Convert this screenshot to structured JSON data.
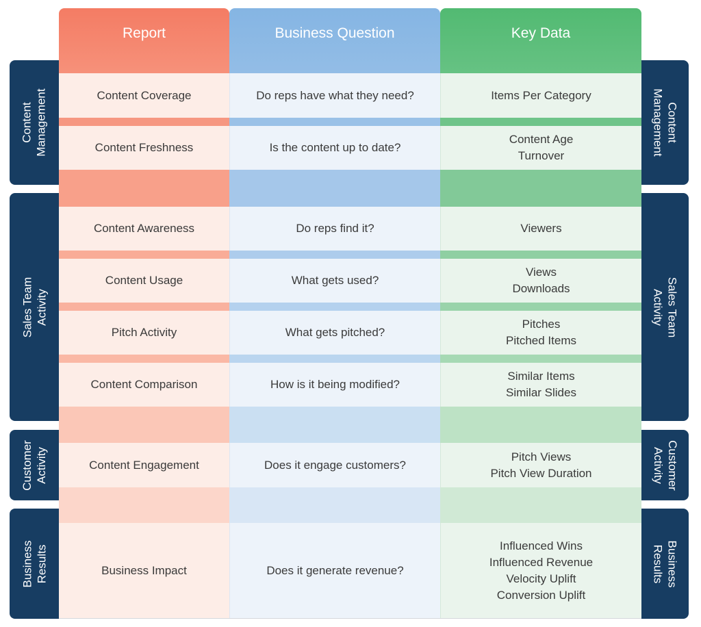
{
  "columns": {
    "report": {
      "header": "Report",
      "color": "#f47c64"
    },
    "question": {
      "header": "Business Question",
      "color": "#85b5e3"
    },
    "keydata": {
      "header": "Key Data",
      "color": "#52ba72"
    }
  },
  "rows": [
    {
      "report": "Content Coverage",
      "question": "Do reps have what they need?",
      "keydata": [
        "Items Per Category"
      ]
    },
    {
      "report": "Content Freshness",
      "question": "Is the content up to date?",
      "keydata": [
        "Content Age",
        "Turnover"
      ]
    },
    {
      "report": "Content Awareness",
      "question": "Do reps find it?",
      "keydata": [
        "Viewers"
      ]
    },
    {
      "report": "Content Usage",
      "question": "What gets used?",
      "keydata": [
        "Views",
        "Downloads"
      ]
    },
    {
      "report": "Pitch Activity",
      "question": "What gets pitched?",
      "keydata": [
        "Pitches",
        "Pitched Items"
      ]
    },
    {
      "report": "Content Comparison",
      "question": "How is it being modified?",
      "keydata": [
        "Similar Items",
        "Similar Slides"
      ]
    },
    {
      "report": "Content Engagement",
      "question": "Does it engage customers?",
      "keydata": [
        "Pitch Views",
        "Pitch View Duration"
      ]
    },
    {
      "report": "Business Impact",
      "question": "Does it generate revenue?",
      "keydata": [
        "Influenced Wins",
        "Influenced Revenue",
        "Velocity Uplift",
        "Conversion Uplift"
      ]
    }
  ],
  "groups": [
    {
      "label": [
        "Content",
        "Management"
      ]
    },
    {
      "label": [
        "Sales Team",
        "Activity"
      ]
    },
    {
      "label": [
        "Customer",
        "Activity"
      ]
    },
    {
      "label": [
        "Business",
        "Results"
      ]
    }
  ],
  "tab_color": "#173d62"
}
